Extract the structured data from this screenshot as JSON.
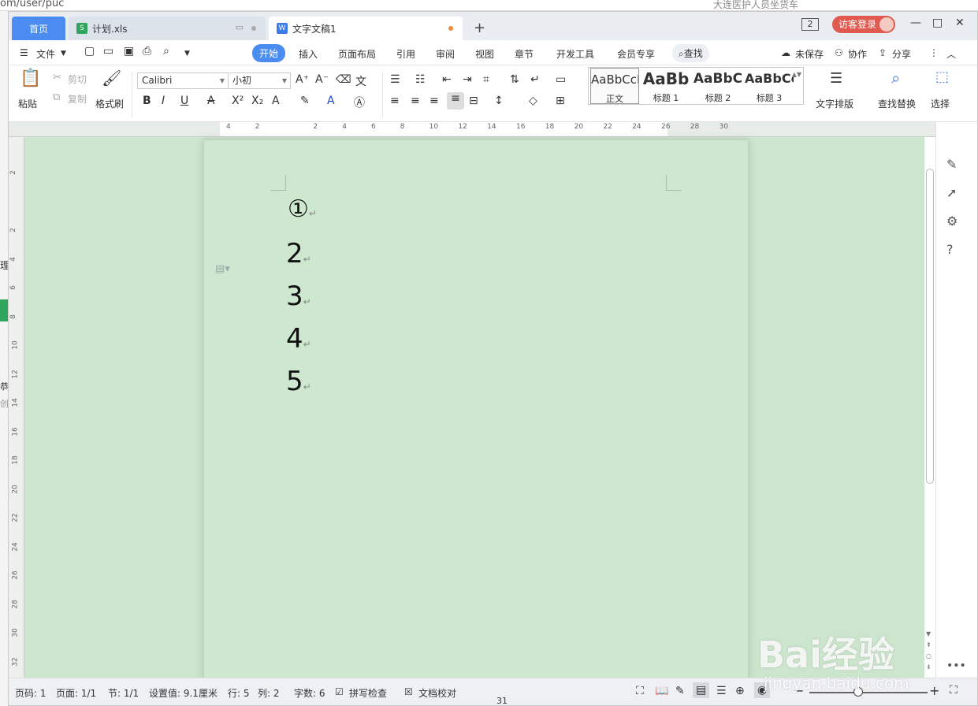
{
  "browser": {
    "url": "om/user/puc",
    "right_text": "大连医护人员坐货车"
  },
  "left_edge": [
    "理",
    "恭",
    "创"
  ],
  "tabs": [
    {
      "label": "首页",
      "type": "home"
    },
    {
      "label": "计划.xls",
      "type": "xls",
      "icon": "S"
    },
    {
      "label": "文字文稿1",
      "type": "doc",
      "icon": "W"
    }
  ],
  "tab_plus": "+",
  "window": {
    "badge": "2",
    "login": "访客登录",
    "min": "—",
    "max": "□",
    "close": "✕"
  },
  "menu": {
    "file": "文件",
    "items": [
      "开始",
      "插入",
      "页面布局",
      "引用",
      "审阅",
      "视图",
      "章节",
      "开发工具",
      "会员专享"
    ],
    "search": "查找",
    "unsaved": "未保存",
    "collab": "协作",
    "share": "分享"
  },
  "ribbon": {
    "paste": "粘贴",
    "cut": "剪切",
    "copy": "复制",
    "format_painter": "格式刷",
    "font_name": "Calibri",
    "font_size": "小初",
    "styles": [
      {
        "preview": "AaBbCcI",
        "name": "正文"
      },
      {
        "preview": "AaBb",
        "name": "标题 1"
      },
      {
        "preview": "AaBbC",
        "name": "标题 2"
      },
      {
        "preview": "AaBbCc",
        "name": "标题 3"
      }
    ],
    "text_layout": "文字排版",
    "find_replace": "查找替换",
    "select": "选择"
  },
  "ruler": {
    "ticks": [
      "4",
      "2",
      "",
      "2",
      "4",
      "6",
      "8",
      "10",
      "12",
      "14",
      "16",
      "18",
      "20",
      "22",
      "24",
      "26",
      "28",
      "30"
    ]
  },
  "vruler": {
    "ticks": [
      "2",
      "",
      "2",
      "4",
      "6",
      "8",
      "10",
      "12",
      "14",
      "16",
      "18",
      "20",
      "22",
      "24",
      "26",
      "28",
      "30",
      "32"
    ]
  },
  "document": {
    "lines": [
      "①",
      "2",
      "3",
      "4",
      "5"
    ],
    "mark": "↵"
  },
  "status": {
    "page_num": "页码: 1",
    "pages": "页面: 1/1",
    "section": "节: 1/1",
    "setting": "设置值: 9.1厘米",
    "row": "行: 5",
    "col": "列: 2",
    "words": "字数: 6",
    "spell": "拼写检查",
    "proof": "文档校对"
  },
  "watermark": {
    "brand": "Bai经验",
    "url": "jingyan.baidu.com"
  },
  "below_text": "31"
}
